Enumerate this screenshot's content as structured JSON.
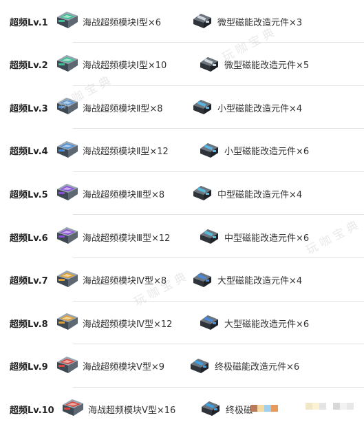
{
  "rows": [
    {
      "level": "超频Lv.1",
      "module": "海战超频模块Ⅰ型×6",
      "part": "微型磁能改造元件×3"
    },
    {
      "level": "超频Lv.2",
      "module": "海战超频模块Ⅰ型×10",
      "part": "微型磁能改造元件×5"
    },
    {
      "level": "超频Lv.3",
      "module": "海战超频模块Ⅱ型×8",
      "part": "小型磁能改造元件×4"
    },
    {
      "level": "超频Lv.4",
      "module": "海战超频模块Ⅱ型×12",
      "part": "小型磁能改造元件×6"
    },
    {
      "level": "超频Lv.5",
      "module": "海战超频模块Ⅲ型×8",
      "part": "中型磁能改造元件×4"
    },
    {
      "level": "超频Lv.6",
      "module": "海战超频模块Ⅲ型×12",
      "part": "中型磁能改造元件×6"
    },
    {
      "level": "超频Lv.7",
      "module": "海战超频模块Ⅳ型×8",
      "part": "大型磁能改造元件×4"
    },
    {
      "level": "超频Lv.8",
      "module": "海战超频模块Ⅳ型×12",
      "part": "大型磁能改造元件×6"
    },
    {
      "level": "超频Lv.9",
      "module": "海战超频模块Ⅴ型×9",
      "part": "终极磁能改造元件×6"
    },
    {
      "level": "超频Lv.10",
      "module": "海战超频模块Ⅴ型×16",
      "part": "终极磁"
    }
  ],
  "icons": {
    "module_tier_colors": [
      "#3dbf93",
      "#3dbf93",
      "#4d8fd6",
      "#4d8fd6",
      "#8a4fd8",
      "#8a4fd8",
      "#e0a030",
      "#e0a030",
      "#d9453c",
      "#d9453c"
    ],
    "part_accent_colors": [
      "#cfd4da",
      "#cfd4da",
      "#5ab3e0",
      "#5ab3e0",
      "#58b8d8",
      "#58b8d8",
      "#4a88d8",
      "#4a88d8",
      "#3e9fe0",
      "#3e9fe0"
    ],
    "module_icon": "overclock-module-icon",
    "part_icon": "magnetic-component-icon"
  },
  "watermarks": [
    "玩咖宝典",
    "玩咖宝典",
    "玩咖宝典",
    "玩咖宝典"
  ]
}
